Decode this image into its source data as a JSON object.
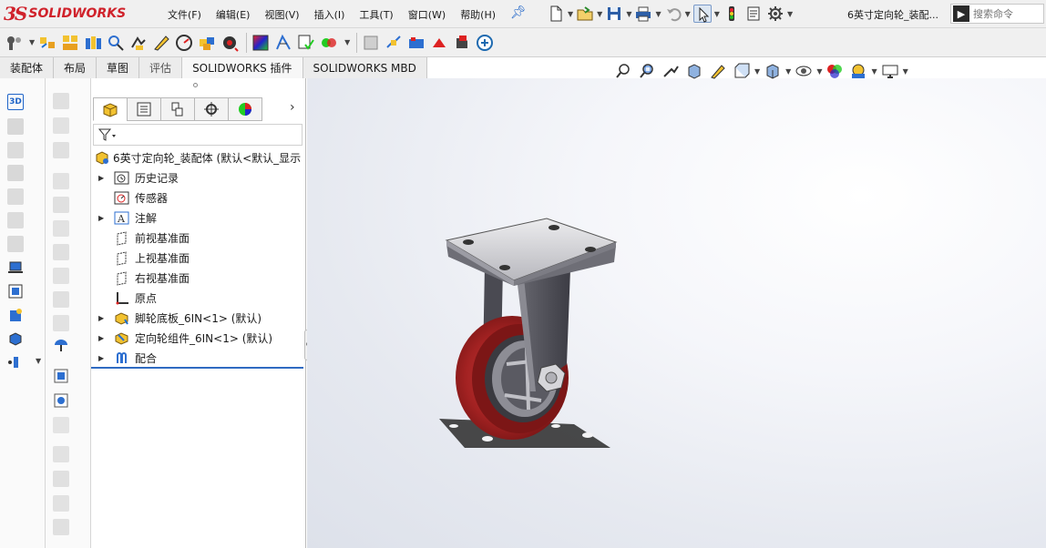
{
  "app": {
    "logo_ds": "3S",
    "logo_text": "SOLIDWORKS",
    "document_title": "6英寸定向轮_装配..."
  },
  "menu": [
    "文件(F)",
    "编辑(E)",
    "视图(V)",
    "插入(I)",
    "工具(T)",
    "窗口(W)",
    "帮助(H)"
  ],
  "search": {
    "placeholder": "搜索命令"
  },
  "command_tabs": [
    {
      "label": "装配体",
      "state": "normal"
    },
    {
      "label": "布局",
      "state": "normal"
    },
    {
      "label": "草图",
      "state": "normal"
    },
    {
      "label": "评估",
      "state": "gray"
    },
    {
      "label": "SOLIDWORKS 插件",
      "state": "active"
    },
    {
      "label": "SOLIDWORKS MBD",
      "state": "normal"
    }
  ],
  "feature_tree": {
    "root": "6英寸定向轮_装配体  (默认<默认_显示",
    "items": [
      {
        "label": "历史记录",
        "icon": "history-icon",
        "expandable": true
      },
      {
        "label": "传感器",
        "icon": "sensor-icon",
        "expandable": false
      },
      {
        "label": "注解",
        "icon": "annotation-icon",
        "expandable": true
      },
      {
        "label": "前视基准面",
        "icon": "plane-icon",
        "expandable": false
      },
      {
        "label": "上视基准面",
        "icon": "plane-icon",
        "expandable": false
      },
      {
        "label": "右视基准面",
        "icon": "plane-icon",
        "expandable": false
      },
      {
        "label": "原点",
        "icon": "origin-icon",
        "expandable": false
      },
      {
        "label": "脚轮底板_6IN<1> (默认)",
        "icon": "part-icon",
        "expandable": true
      },
      {
        "label": "定向轮组件_6IN<1> (默认)",
        "icon": "subassembly-icon",
        "expandable": true
      },
      {
        "label": "配合",
        "icon": "mates-icon",
        "expandable": true
      }
    ]
  },
  "colors": {
    "brand_red": "#d0222b",
    "accent_blue": "#2f6bc2",
    "wheel_red": "#9a1f1f",
    "bracket_gray": "#5a5a60"
  }
}
